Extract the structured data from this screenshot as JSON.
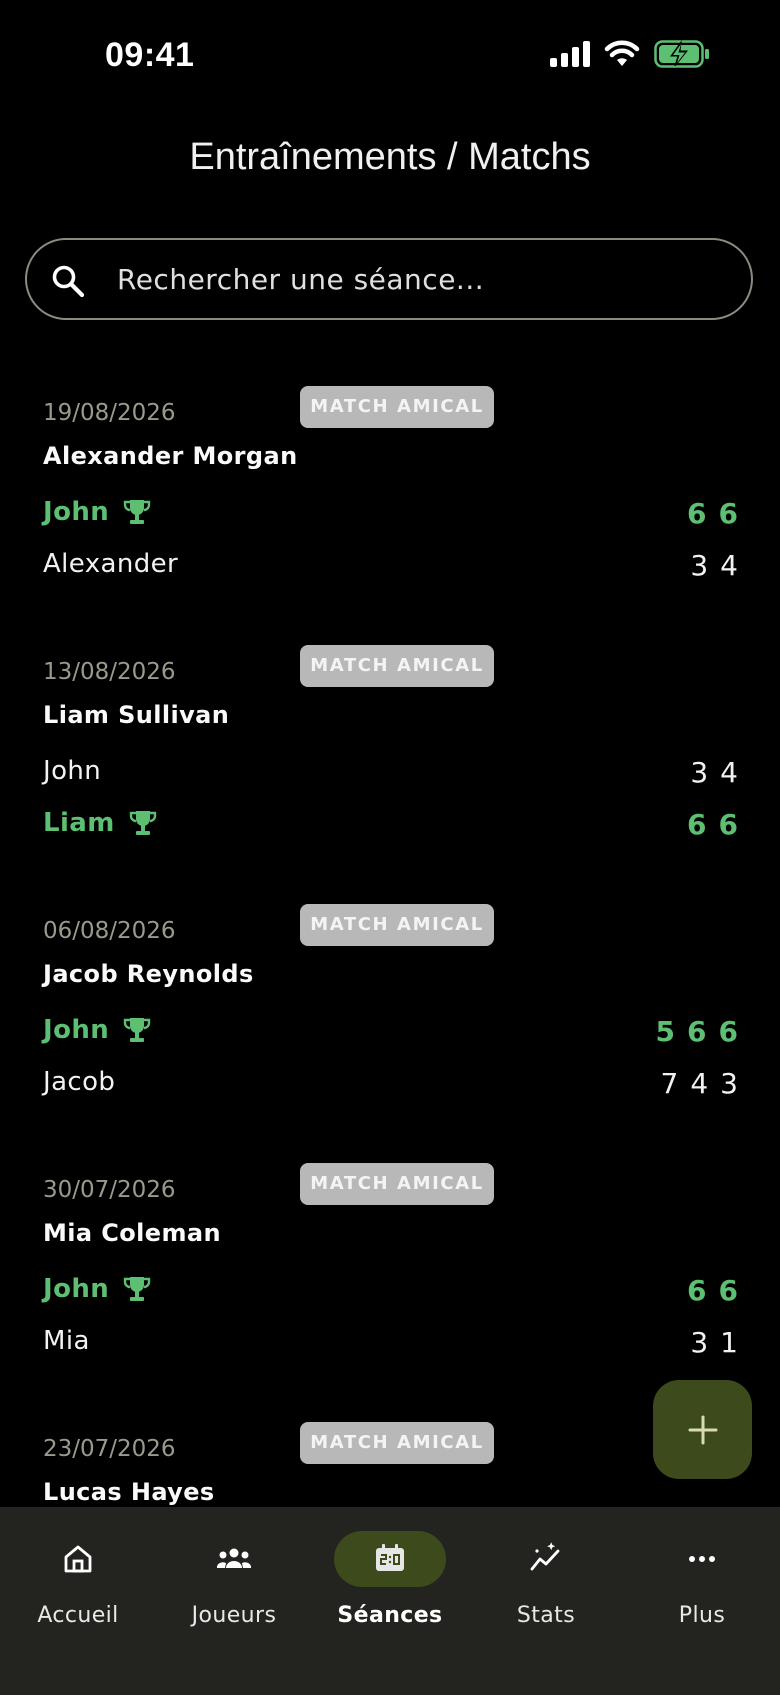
{
  "status_bar": {
    "time": "09:41",
    "icons": [
      "signal-icon",
      "wifi-icon",
      "battery-charging-icon"
    ]
  },
  "header": {
    "title": "Entraînements / Matchs"
  },
  "search": {
    "placeholder": "Rechercher une séance..."
  },
  "sessions": [
    {
      "date": "19/08/2026",
      "badge": "MATCH AMICAL",
      "title": "Alexander Morgan",
      "players": [
        {
          "name": "John",
          "winner": true,
          "scores": [
            "6",
            "6"
          ]
        },
        {
          "name": "Alexander",
          "winner": false,
          "scores": [
            "3",
            "4"
          ]
        }
      ]
    },
    {
      "date": "13/08/2026",
      "badge": "MATCH AMICAL",
      "title": "Liam Sullivan",
      "players": [
        {
          "name": "John",
          "winner": false,
          "scores": [
            "3",
            "4"
          ]
        },
        {
          "name": "Liam",
          "winner": true,
          "scores": [
            "6",
            "6"
          ]
        }
      ]
    },
    {
      "date": "06/08/2026",
      "badge": "MATCH AMICAL",
      "title": "Jacob Reynolds",
      "players": [
        {
          "name": "John",
          "winner": true,
          "scores": [
            "5",
            "6",
            "6"
          ]
        },
        {
          "name": "Jacob",
          "winner": false,
          "scores": [
            "7",
            "4",
            "3"
          ]
        }
      ]
    },
    {
      "date": "30/07/2026",
      "badge": "MATCH AMICAL",
      "title": "Mia Coleman",
      "players": [
        {
          "name": "John",
          "winner": true,
          "scores": [
            "6",
            "6"
          ]
        },
        {
          "name": "Mia",
          "winner": false,
          "scores": [
            "3",
            "1"
          ]
        }
      ]
    },
    {
      "date": "23/07/2026",
      "badge": "MATCH AMICAL",
      "title": "Lucas Hayes",
      "players": []
    }
  ],
  "fab": {
    "icon": "plus-icon"
  },
  "bottom_nav": {
    "items": [
      {
        "label": "Accueil",
        "icon": "home-icon",
        "active": false
      },
      {
        "label": "Joueurs",
        "icon": "players-icon",
        "active": false
      },
      {
        "label": "Séances",
        "icon": "scoreboard-icon",
        "active": true
      },
      {
        "label": "Stats",
        "icon": "stats-icon",
        "active": false
      },
      {
        "label": "Plus",
        "icon": "more-icon",
        "active": false
      }
    ]
  },
  "colors": {
    "background": "#000000",
    "winner_green": "#5dbf72",
    "accent_olive": "#3d4a1c",
    "badge_gray": "#b8b8b8",
    "nav_background": "#23241f",
    "fab_icon": "#d8dcb0"
  }
}
